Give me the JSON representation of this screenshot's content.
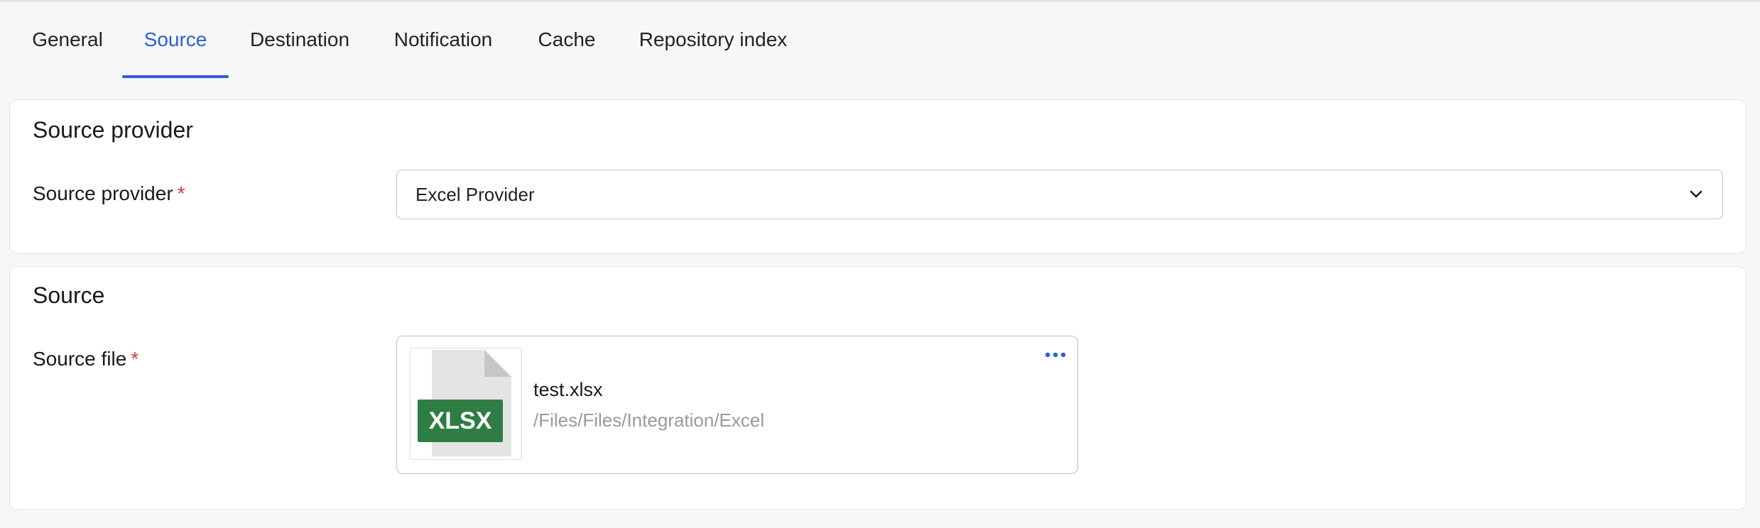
{
  "tabs": [
    {
      "label": "General",
      "active": false
    },
    {
      "label": "Source",
      "active": true
    },
    {
      "label": "Destination",
      "active": false
    },
    {
      "label": "Notification",
      "active": false
    },
    {
      "label": "Cache",
      "active": false
    },
    {
      "label": "Repository index",
      "active": false
    }
  ],
  "provider_section": {
    "title": "Source provider",
    "field_label": "Source provider",
    "required_mark": "*",
    "selected_value": "Excel Provider"
  },
  "source_section": {
    "title": "Source",
    "field_label": "Source file",
    "required_mark": "*",
    "file": {
      "type_badge": "XLSX",
      "name": "test.xlsx",
      "path": "/Files/Files/Integration/Excel"
    }
  },
  "colors": {
    "accent": "#2b5fd9",
    "required": "#d13a3a",
    "excel_green": "#2e7d43"
  },
  "icons": {
    "select_chevron": "chevron-down-icon",
    "file_icon": "xlsx-file-icon",
    "more_menu": "more-horizontal-icon"
  }
}
